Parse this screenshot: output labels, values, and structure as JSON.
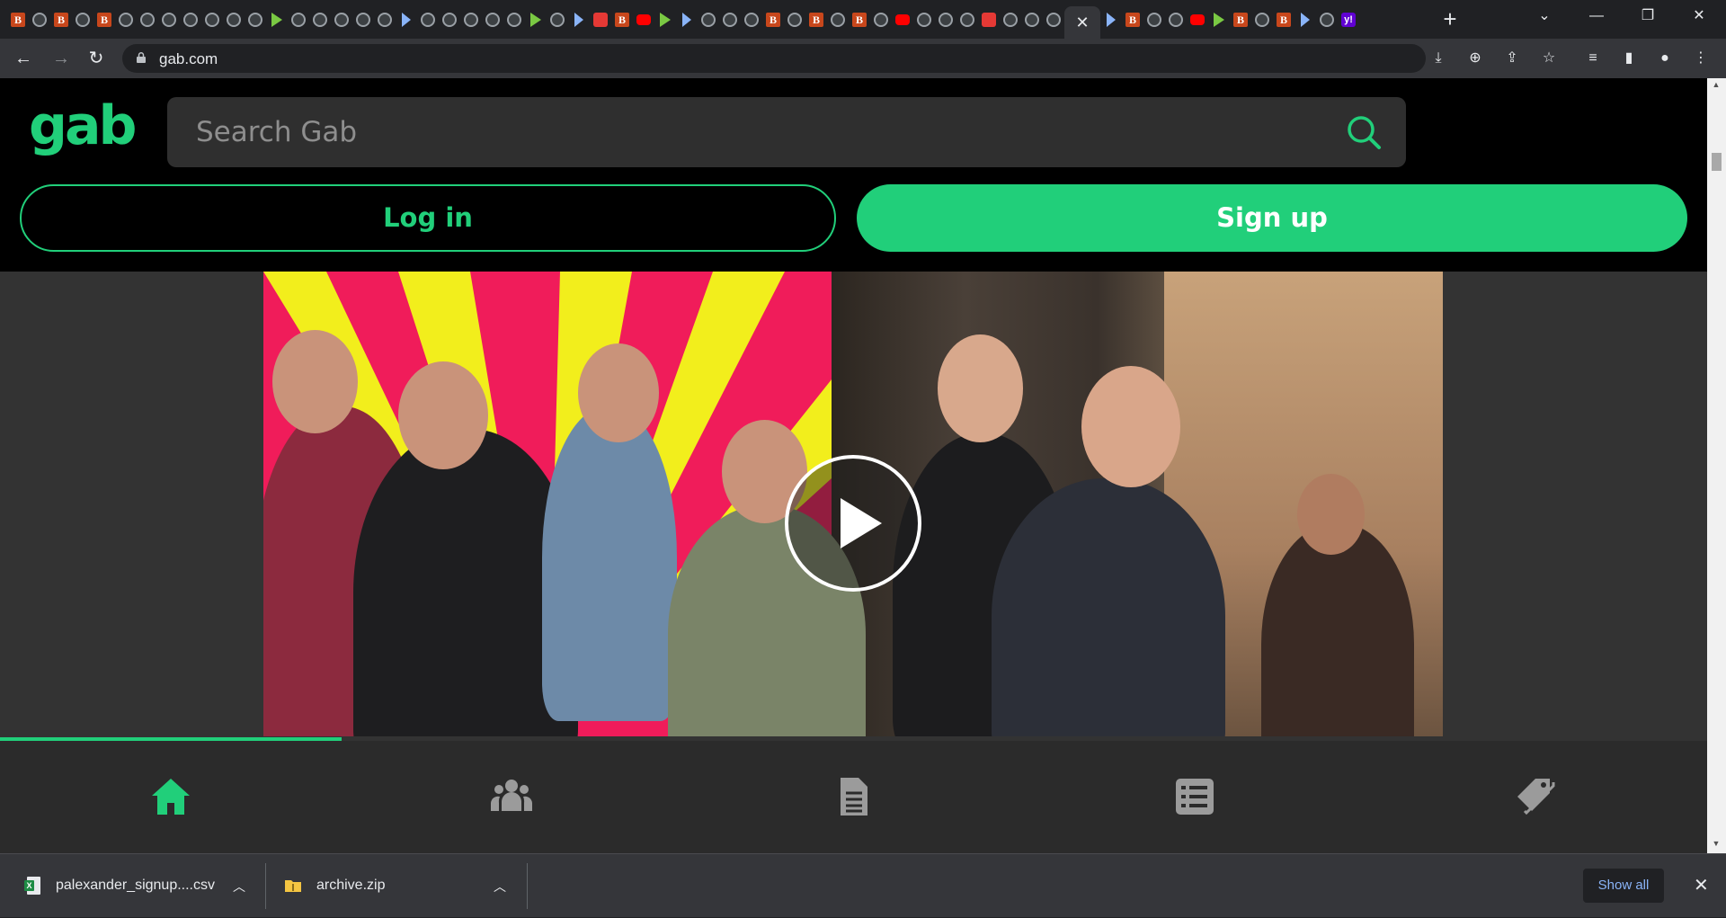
{
  "browser": {
    "active_tab_close": "✕",
    "new_tab": "+",
    "tab_favicons": [
      "b",
      "g",
      "b",
      "g",
      "b",
      "g",
      "g",
      "g",
      "g",
      "g",
      "g",
      "g",
      "play",
      "g",
      "g",
      "g",
      "g",
      "g",
      "gray",
      "g",
      "g",
      "g",
      "g",
      "g",
      "play",
      "g",
      "gray",
      "red",
      "b",
      "yt",
      "play",
      "gray",
      "g",
      "g",
      "g",
      "b",
      "g",
      "b",
      "g",
      "b",
      "g",
      "yt",
      "g",
      "g",
      "g",
      "red",
      "g",
      "g",
      "g"
    ],
    "after_active_favicons": [
      "gray",
      "b",
      "g",
      "g",
      "yt",
      "play",
      "b",
      "g",
      "b",
      "gray",
      "g",
      "yh"
    ],
    "url": "gab.com"
  },
  "gab": {
    "logo": "gab",
    "search_placeholder": "Search Gab",
    "login_label": "Log in",
    "signup_label": "Sign up",
    "brand_color": "#21cf7a",
    "video": {
      "progress": 0.2
    },
    "bottom_nav": [
      "home-icon",
      "groups-icon",
      "news-icon",
      "lists-icon",
      "tags-icon"
    ],
    "active_nav": "home-icon"
  },
  "downloads": {
    "items": [
      {
        "name": "palexander_signup....csv",
        "icon": "excel-icon"
      },
      {
        "name": "archive.zip",
        "icon": "folder-zip-icon"
      }
    ],
    "show_all_label": "Show all",
    "close_label": "✕"
  }
}
